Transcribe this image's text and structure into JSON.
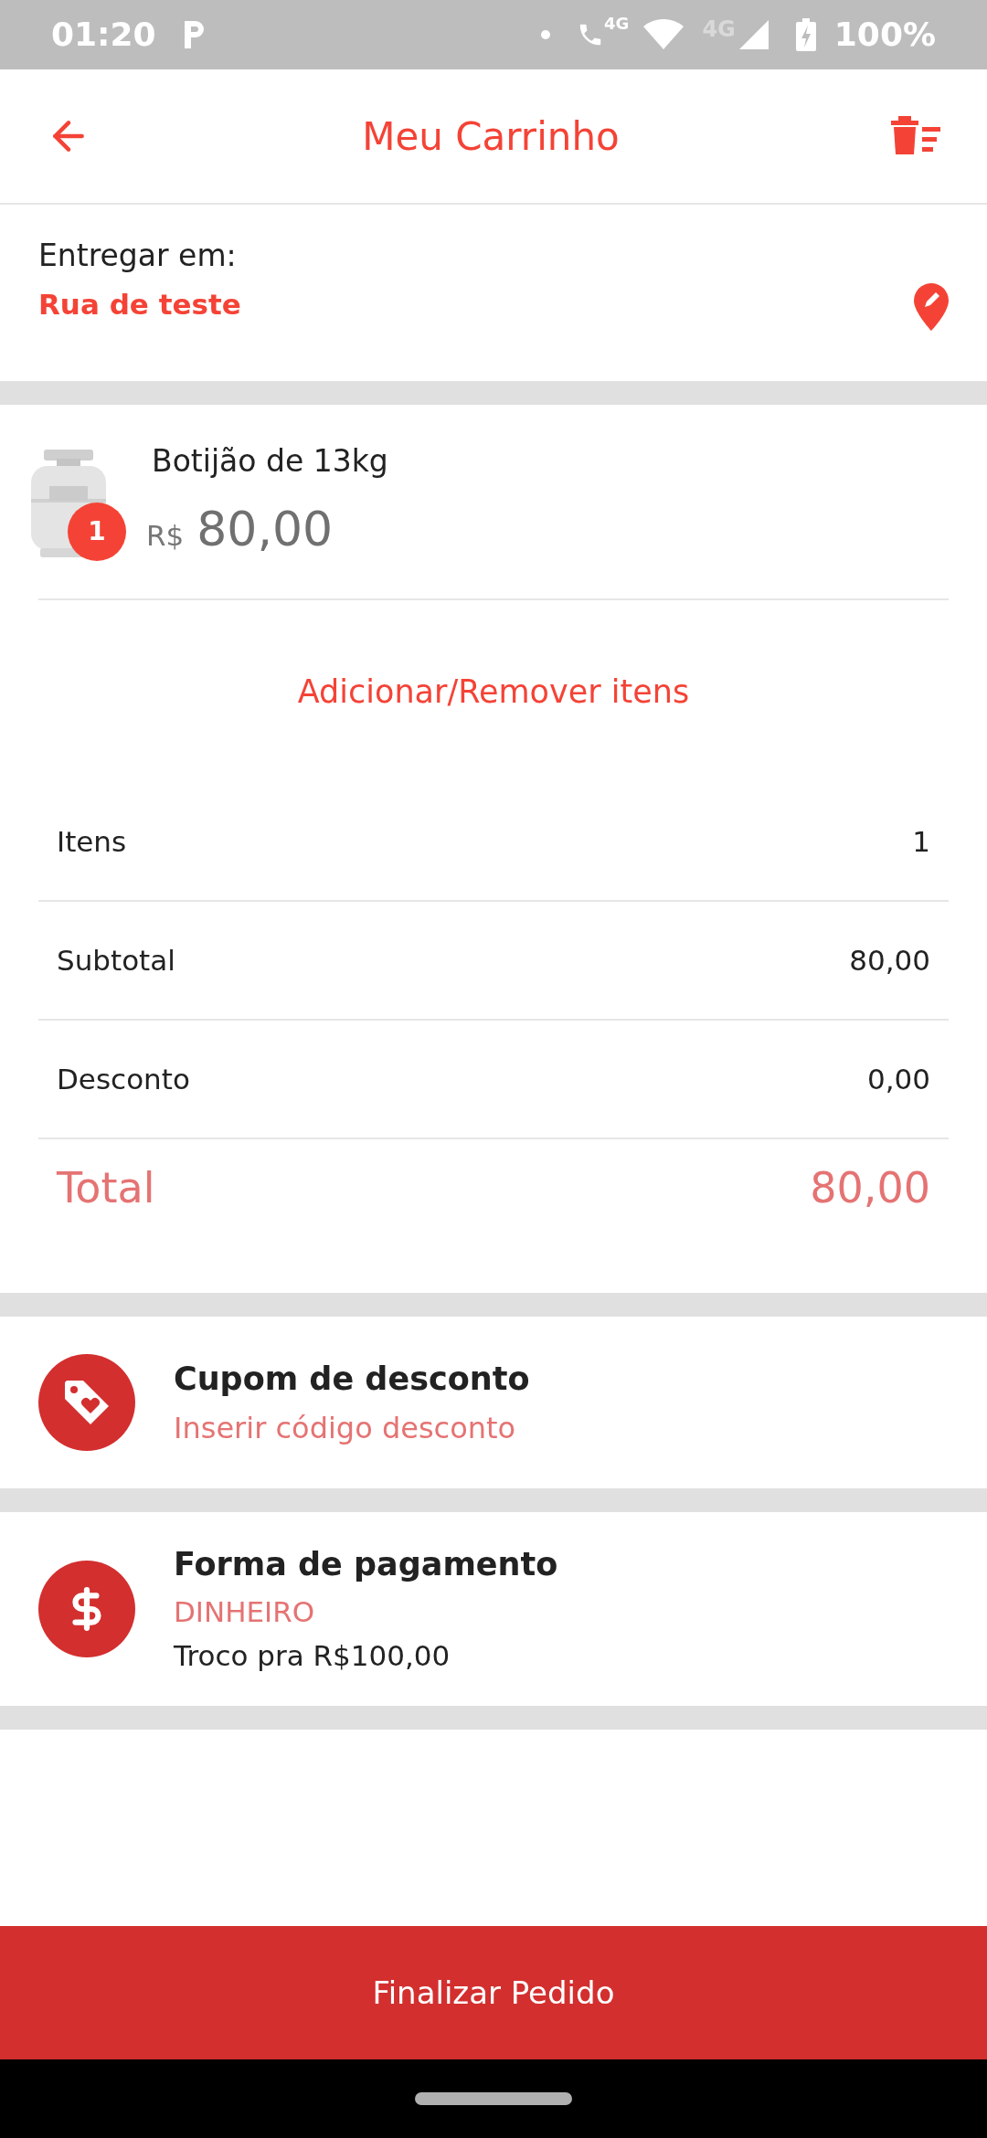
{
  "status_bar": {
    "time": "01:20",
    "network_labels": [
      "4G",
      "4G"
    ],
    "battery": "100%"
  },
  "header": {
    "title": "Meu Carrinho"
  },
  "delivery": {
    "label": "Entregar em:",
    "address": "Rua de teste"
  },
  "cart_items": [
    {
      "name": "Botijão de 13kg",
      "currency": "R$",
      "price": "80,00",
      "quantity": "1"
    }
  ],
  "add_remove_link": "Adicionar/Remover itens",
  "summary": [
    {
      "label": "Itens",
      "value": "1",
      "kind": "line"
    },
    {
      "label": "Subtotal",
      "value": "80,00",
      "kind": "line"
    },
    {
      "label": "Desconto",
      "value": "0,00",
      "kind": "line"
    },
    {
      "label": "Total",
      "value": "80,00",
      "kind": "total"
    }
  ],
  "coupon": {
    "title": "Cupom de desconto",
    "subtitle": "Inserir código desconto"
  },
  "payment": {
    "title": "Forma de pagamento",
    "method": "DINHEIRO",
    "change": "Troco pra R$100,00"
  },
  "checkout_button": "Finalizar Pedido"
}
